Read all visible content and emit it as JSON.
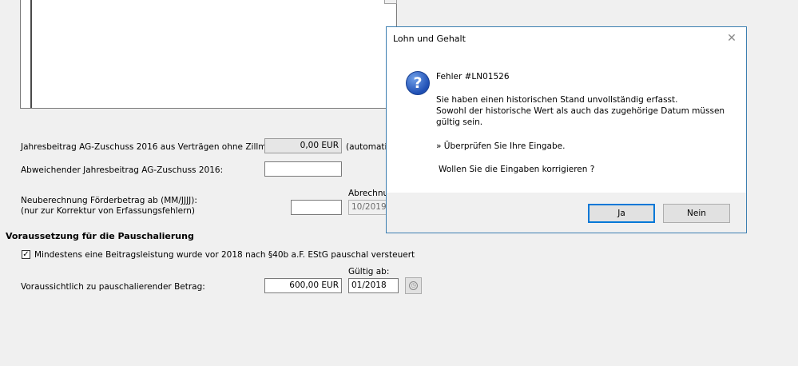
{
  "form": {
    "row1_label": "Jahresbeitrag AG-Zuschuss 2016 aus Verträgen ohne Zillmerung:",
    "row1_value": "0,00 EUR",
    "row1_suffix": "(automatis",
    "row2_label": "Abweichender Jahresbeitrag AG-Zuschuss 2016:",
    "row2_value": "",
    "row3_label_line1": "Neuberechnung Förderbetrag ab (MM/JJJJ):",
    "row3_label_line2": "(nur zur Korrektur von Erfassungsfehlern)",
    "row3_value": "",
    "row3_caption": "Abrechnur",
    "row3_date": "10/2019",
    "section_title": "Voraussetzung für die Pauschalierung",
    "checkbox_label": "Mindestens eine Beitragsleistung wurde vor 2018 nach §40b a.F. EStG pauschal versteuert",
    "checkbox_checked": true,
    "checkbox_mark": "✓",
    "valid_from_label": "Gültig ab:",
    "row4_label": "Voraussichtlich zu pauschalierender Betrag:",
    "row4_value": "600,00 EUR",
    "row4_date": "01/2018"
  },
  "dialog": {
    "title": "Lohn und Gehalt",
    "close_glyph": "✕",
    "icon_glyph": "?",
    "error_code": "Fehler #LN01526",
    "line1": "Sie haben einen historischen Stand unvollständig erfasst.",
    "line2": "Sowohl der historische Wert als auch das zugehörige Datum müssen",
    "line3": "gültig sein.",
    "hint": "» Überprüfen Sie Ihre Eingabe.",
    "question": "Wollen Sie die Eingaben korrigieren ?",
    "yes_label": "Ja",
    "no_label": "Nein"
  }
}
